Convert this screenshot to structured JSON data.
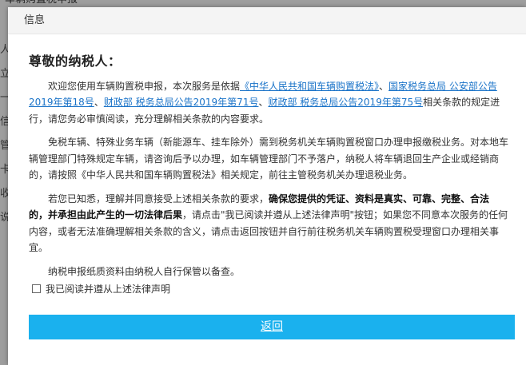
{
  "background": {
    "tab_label": "车辆购置税申报"
  },
  "dialog": {
    "title": "信息",
    "greeting": "尊敬的纳税人：",
    "p1": {
      "t1": "欢迎您使用车辆购置税申报，本次服务是依据",
      "l1": "《中华人民共和国车辆购置税法》",
      "t2": "、",
      "l2": "国家税务总局 公安部公告2019年第18号",
      "t3": "、",
      "l3": "财政部 税务总局公告2019年第71号",
      "t4": "、",
      "l4": "财政部 税务总局公告2019年第75号",
      "t5": "相关条款的规定进行，请您务必审慎阅读，充分理解相关条款的内容要求。"
    },
    "p2": "免税车辆、特殊业务车辆（新能源车、挂车除外）需到税务机关车辆购置税窗口办理申报缴税业务。对本地车辆管理部门特殊规定车辆，请咨询后予以办理，如车辆管理部门不予落户，纳税人将车辆退回生产企业或经销商的，请按照《中华人民共和国车辆购置税法》相关规定，前往主管税务机关办理退税业务。",
    "p3": {
      "t1": "若您已知悉，理解并同意接受上述相关条款的要求，",
      "b1": "确保您提供的凭证、资料是真实、可靠、完整、合法的，并承担由此产生的一切法律后果",
      "t2": "，请点击\"我已阅读并遵从上述法律声明\"按钮；如果您不同意本次服务的任何内容，或者无法准确理解相关条款的含义，请点击返回按钮并自行前往税务机关车辆购置税受理窗口办理相关事宜。"
    },
    "p4": "纳税申报纸质资料由纳税人自行保管以备查。",
    "agree_label": "我已阅读并遵从上述法律声明",
    "back_button": "返回"
  },
  "colors": {
    "link": "#1a73c8",
    "button": "#1ab1ee"
  }
}
